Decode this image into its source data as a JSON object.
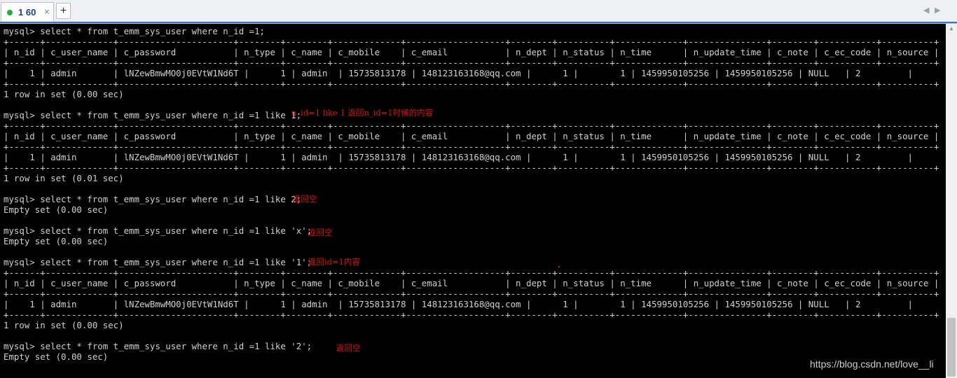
{
  "tabbar": {
    "tab_title": "1 60",
    "close_glyph": "×",
    "add_glyph": "+",
    "nav_left": "◀",
    "nav_right": "▶",
    "status_color": "#1fae3a",
    "accent_color": "#2b7bd6"
  },
  "terminal": {
    "lines": [
      "mysql> select * from t_emm_sys_user where n_id =1;",
      "+------+-------------+----------------------+--------+--------+-------------+-------------------+--------+----------+-------------+---------------+--------+-----------+----------+",
      "| n_id | c_user_name | c_password           | n_type | c_name | c_mobile    | c_email           | n_dept | n_status | n_time      | n_update_time | c_note | c_ec_code | n_source |",
      "+------+-------------+----------------------+--------+--------+-------------+-------------------+--------+----------+-------------+---------------+--------+-----------+----------+",
      "|    1 | admin       | lNZewBmwMO0j0EVtW1Nd6T |      1 | admin  | 15735813178 | 148123163168@qq.com |      1 |        1 | 1459950105256 | 1459950105256 | NULL   | 2         |        0 |",
      "+------+-------------+----------------------+--------+--------+-------------+-------------------+--------+----------+-------------+---------------+--------+-----------+----------+",
      "1 row in set (0.00 sec)",
      "",
      "mysql> select * from t_emm_sys_user where n_id =1 like 1;",
      "+------+-------------+----------------------+--------+--------+-------------+-------------------+--------+----------+-------------+---------------+--------+-----------+----------+",
      "| n_id | c_user_name | c_password           | n_type | c_name | c_mobile    | c_email           | n_dept | n_status | n_time      | n_update_time | c_note | c_ec_code | n_source |",
      "+------+-------------+----------------------+--------+--------+-------------+-------------------+--------+----------+-------------+---------------+--------+-----------+----------+",
      "|    1 | admin       | lNZewBmwMO0j0EVtW1Nd6T |      1 | admin  | 15735813178 | 148123163168@qq.com |      1 |        1 | 1459950105256 | 1459950105256 | NULL   | 2         |        0 |",
      "+------+-------------+----------------------+--------+--------+-------------+-------------------+--------+----------+-------------+---------------+--------+-----------+----------+",
      "1 row in set (0.01 sec)",
      "",
      "mysql> select * from t_emm_sys_user where n_id =1 like 2;",
      "Empty set (0.00 sec)",
      "",
      "mysql> select * from t_emm_sys_user where n_id =1 like 'x';",
      "Empty set (0.00 sec)",
      "",
      "mysql> select * from t_emm_sys_user where n_id =1 like '1';",
      "+------+-------------+----------------------+--------+--------+-------------+-------------------+--------+----------+-------------+---------------+--------+-----------+----------+",
      "| n_id | c_user_name | c_password           | n_type | c_name | c_mobile    | c_email           | n_dept | n_status | n_time      | n_update_time | c_note | c_ec_code | n_source |",
      "+------+-------------+----------------------+--------+--------+-------------+-------------------+--------+----------+-------------+---------------+--------+-----------+----------+",
      "|    1 | admin       | lNZewBmwMO0j0EVtW1Nd6T |      1 | admin  | 15735813178 | 148123163168@qq.com |      1 |        1 | 1459950105256 | 1459950105256 | NULL   | 2         |        0 |",
      "+------+-------------+----------------------+--------+--------+-------------+-------------------+--------+----------+-------------+---------------+--------+-----------+----------+",
      "1 row in set (0.00 sec)",
      "",
      "mysql> select * from t_emm_sys_user where n_id =1 like '2';",
      "Empty set (0.00 sec)"
    ],
    "annotations": [
      "n_id=1 like 1 返回n_id=1时候的内容",
      "返回空",
      "返回空",
      "返回id=1内容",
      "返回空"
    ],
    "annotation_color": "#e01010",
    "text_color": "#d0d0d0",
    "background": "#000000"
  },
  "watermark": "https://blog.csdn.net/love__li"
}
